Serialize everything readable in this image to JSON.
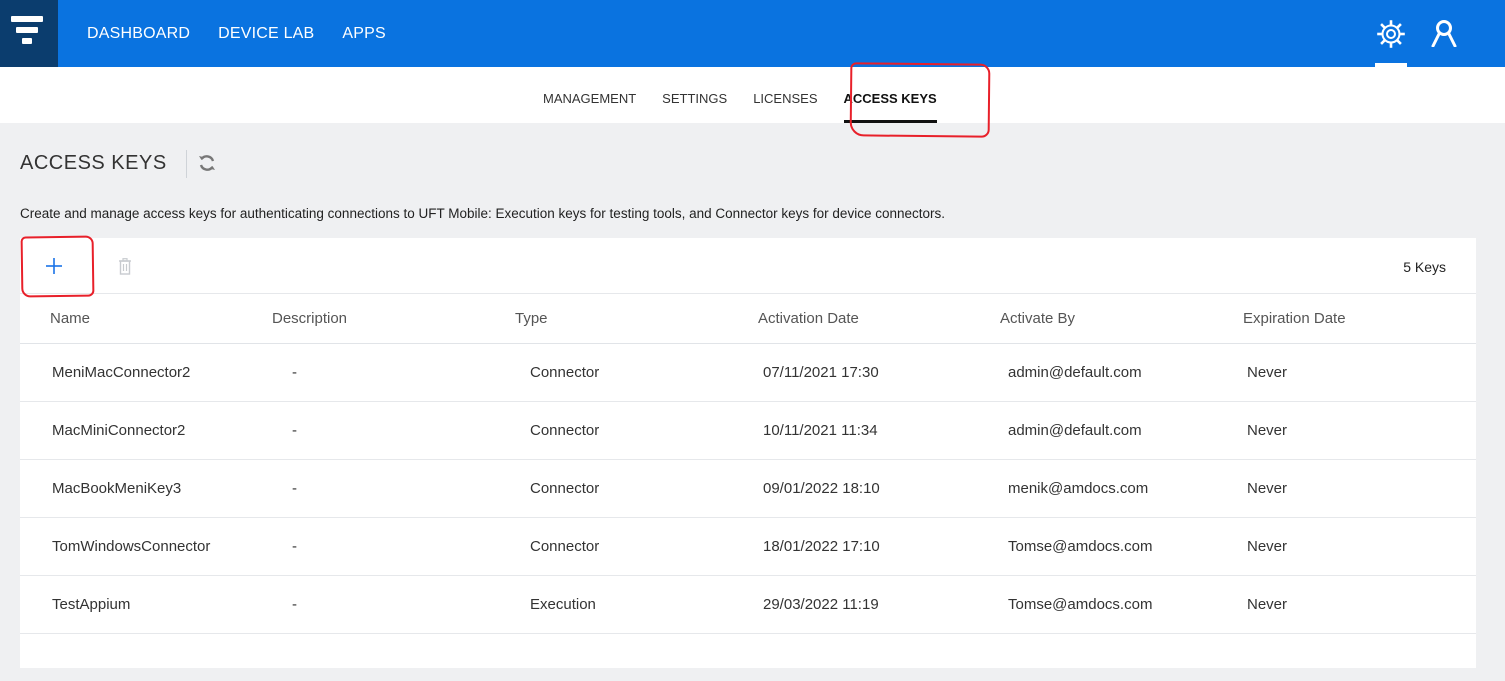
{
  "topnav": {
    "items": [
      "DASHBOARD",
      "DEVICE LAB",
      "APPS"
    ]
  },
  "icons": {
    "logo": "funnel-logo-icon",
    "settings": "gear-icon",
    "user": "user-icon",
    "refresh": "refresh-icon",
    "add": "plus-icon",
    "delete": "trash-icon"
  },
  "subnav": {
    "tabs": [
      "MANAGEMENT",
      "SETTINGS",
      "LICENSES",
      "ACCESS KEYS"
    ],
    "active": "ACCESS KEYS"
  },
  "page": {
    "title": "ACCESS KEYS",
    "description": "Create and manage access keys for authenticating connections to UFT Mobile: Execution keys for testing tools, and Connector keys for device connectors."
  },
  "toolbar": {
    "key_count": "5 Keys"
  },
  "table": {
    "columns": [
      "Name",
      "Description",
      "Type",
      "Activation Date",
      "Activate By",
      "Expiration Date"
    ],
    "rows": [
      [
        "MeniMacConnector2",
        "-",
        "Connector",
        "07/11/2021 17:30",
        "admin@default.com",
        "Never"
      ],
      [
        "MacMiniConnector2",
        "-",
        "Connector",
        "10/11/2021 11:34",
        "admin@default.com",
        "Never"
      ],
      [
        "MacBookMeniKey3",
        "-",
        "Connector",
        "09/01/2022 18:10",
        "menik@amdocs.com",
        "Never"
      ],
      [
        "TomWindowsConnector",
        "-",
        "Connector",
        "18/01/2022 17:10",
        "Tomse@amdocs.com",
        "Never"
      ],
      [
        "TestAppium",
        "-",
        "Execution",
        "29/03/2022 11:19",
        "Tomse@amdocs.com",
        "Never"
      ]
    ]
  },
  "colors": {
    "topbar": "#0a73e0",
    "logo_bg": "#0b3d6e",
    "page_bg": "#eff0f2",
    "accent": "#0a73e0",
    "annotation": "#e8202a"
  }
}
